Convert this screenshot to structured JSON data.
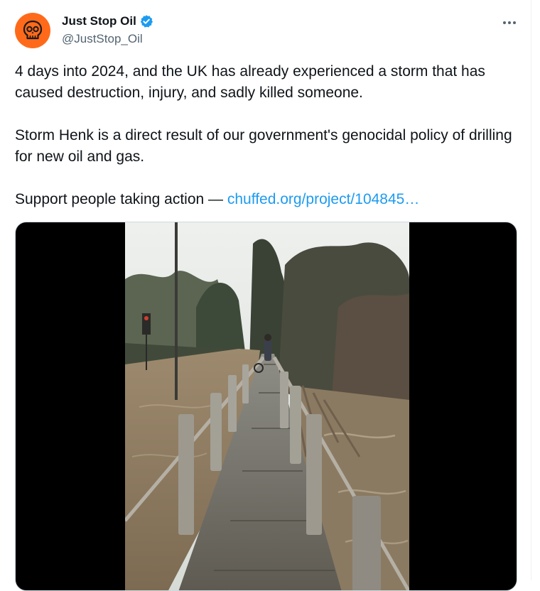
{
  "tweet": {
    "display_name": "Just Stop Oil",
    "handle": "@JustStop_Oil",
    "paragraph_1": "4 days into 2024, and the UK has already experienced a storm that has caused destruction, injury, and sadly killed someone.",
    "paragraph_2": "Storm Henk is a direct result of our government's genocidal policy of drilling for new oil and gas.",
    "paragraph_3_text": "Support people taking action — ",
    "link_text": "chuffed.org/project/104845…"
  },
  "icons": {
    "avatar": "skull-icon",
    "verified": "verified-badge-icon",
    "more": "more-options-icon"
  },
  "colors": {
    "avatar_bg": "#ff6a1a",
    "link": "#1d9bf0",
    "verified": "#1d9bf0",
    "text": "#0f1419",
    "secondary_text": "#536471"
  }
}
